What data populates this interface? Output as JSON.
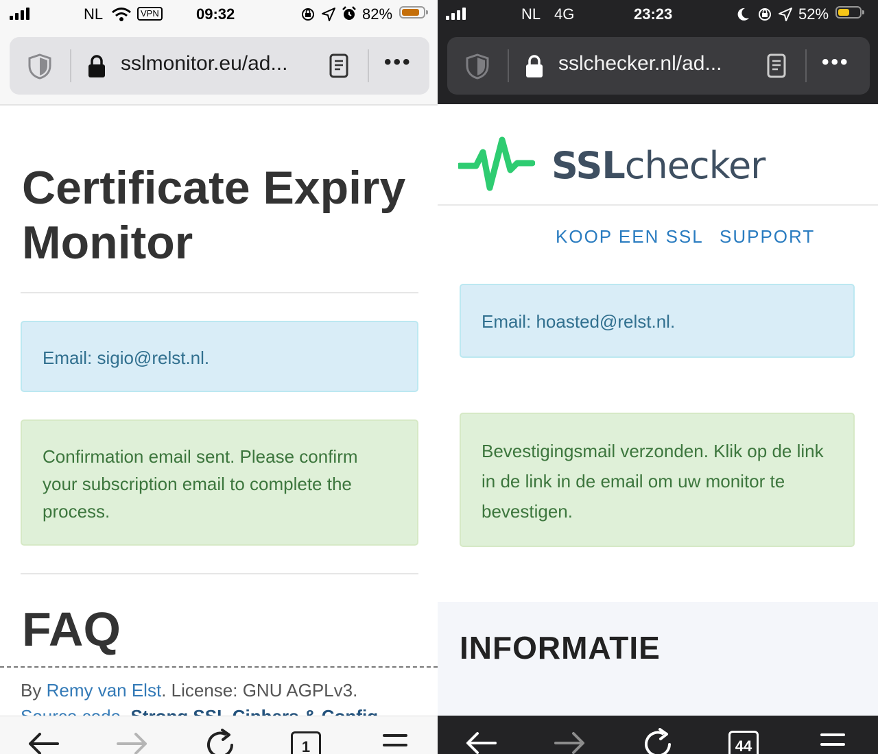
{
  "left": {
    "status": {
      "carrier": "NL",
      "vpn": "VPN",
      "time": "09:32",
      "battery": "82%",
      "battery_level": 0.82,
      "battery_color": "#c56f0a"
    },
    "url": "sslmonitor.eu/ad...",
    "page_title": "Certificate Expiry Monitor",
    "email_alert": "Email: sigio@relst.nl.",
    "success_alert": "Confirmation email sent. Please confirm your subscription email to complete the process.",
    "faq_heading": "FAQ",
    "footer": {
      "by": "By ",
      "author": "Remy van Elst",
      "license": ". License: GNU AGPLv3.",
      "source": "Source code",
      "sep": ". ",
      "strong_link": "Strong SSL Ciphers & Config"
    },
    "tab_count": "1"
  },
  "right": {
    "status": {
      "carrier": "NL",
      "network": "4G",
      "time": "23:23",
      "battery": "52%",
      "battery_level": 0.52,
      "battery_color": "#f5c518"
    },
    "url": "sslchecker.nl/ad...",
    "logo": {
      "bold": "SSL",
      "rest": "checker"
    },
    "nav": [
      "KOOP EEN SSL",
      "SUPPORT"
    ],
    "email_alert": "Email: hoasted@relst.nl.",
    "success_alert": "Bevestigingsmail verzonden. Klik op de link in de link in de email om uw monitor te bevestigen.",
    "info_heading": "INFORMATIE",
    "tab_count": "44"
  },
  "colors": {
    "info_bg": "#d9edf7",
    "info_text": "#31708f",
    "success_bg": "#dff0d8",
    "success_text": "#3c763d",
    "link": "#337ab7",
    "nav_link": "#2a7cc0",
    "logo_green": "#2ecc71"
  },
  "icons": [
    "cellular-signal-icon",
    "wifi-icon",
    "orientation-lock-icon",
    "location-arrow-icon",
    "alarm-icon",
    "moon-icon",
    "battery-icon",
    "shield-icon",
    "lock-icon",
    "reader-mode-icon",
    "more-icon",
    "back-arrow-icon",
    "forward-arrow-icon",
    "reload-icon",
    "tabs-icon",
    "menu-icon",
    "pulse-logo-icon"
  ]
}
